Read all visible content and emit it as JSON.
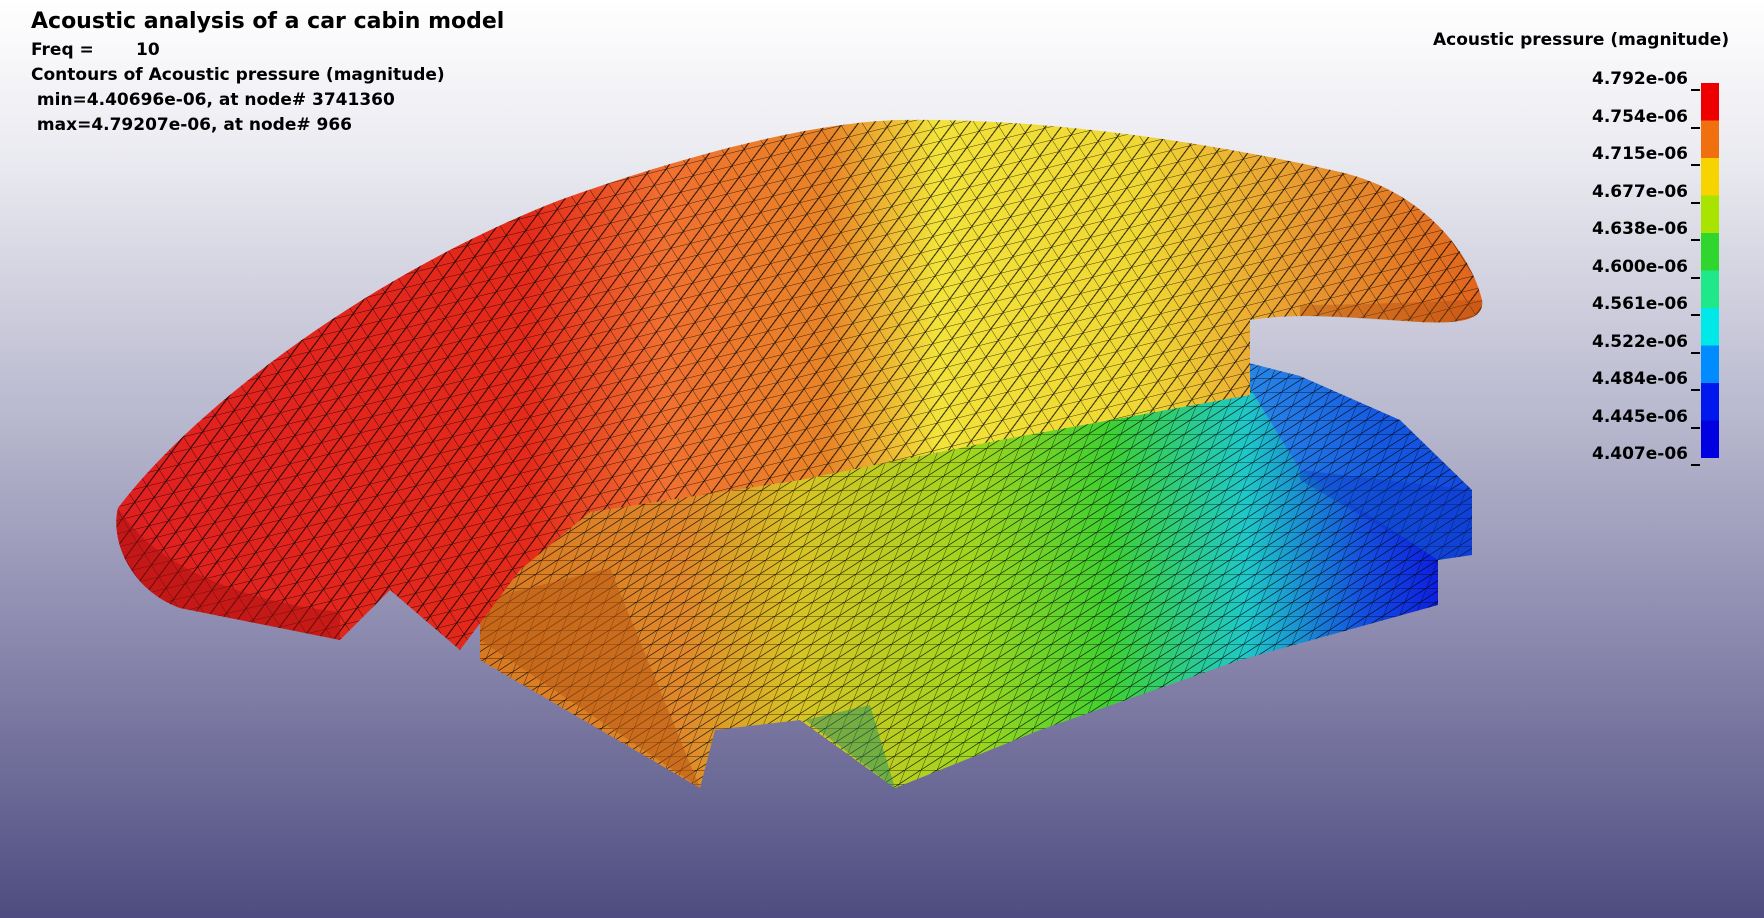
{
  "header": {
    "title": "Acoustic analysis of a car cabin model",
    "freq_label": "Freq =",
    "freq_value": "10",
    "contours_label": "Contours of Acoustic pressure (magnitude)",
    "min_line": " min=4.40696e-06, at node# 3741360",
    "max_line": " max=4.79207e-06, at node# 966"
  },
  "legend": {
    "title": "Acoustic pressure (magnitude)",
    "labels": [
      "4.792e-06",
      "4.754e-06",
      "4.715e-06",
      "4.677e-06",
      "4.638e-06",
      "4.600e-06",
      "4.561e-06",
      "4.522e-06",
      "4.484e-06",
      "4.445e-06",
      "4.407e-06"
    ],
    "colors": [
      "#ee0000",
      "#f07010",
      "#f7d400",
      "#a8e400",
      "#2ed62e",
      "#1ee88a",
      "#00e8e8",
      "#008cff",
      "#0018ee",
      "#0000e0"
    ]
  },
  "colors": {
    "red": "#e52525",
    "orange": "#e07a24",
    "yellow": "#f2e038",
    "green": "#58d228",
    "cyan": "#1ec8d8",
    "blue": "#1448e0"
  }
}
